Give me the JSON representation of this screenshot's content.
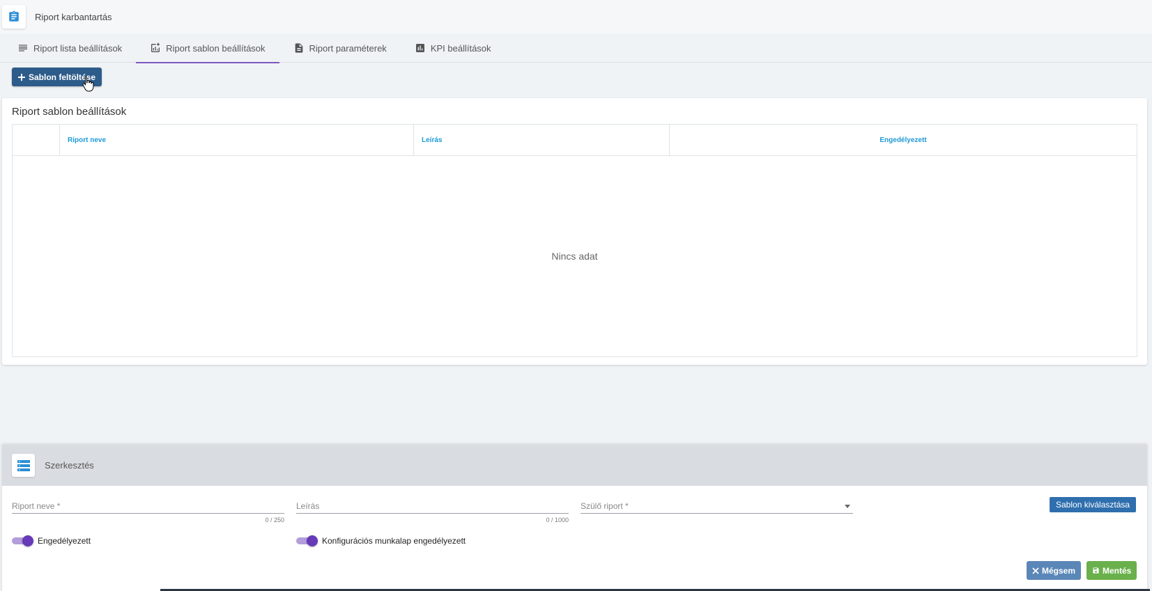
{
  "header": {
    "title": "Riport karbantartás"
  },
  "tabs": [
    {
      "label": "Riport lista beállítások",
      "icon": "list-icon"
    },
    {
      "label": "Riport sablon beállítások",
      "icon": "chart-add-icon",
      "active": true
    },
    {
      "label": "Riport paraméterek",
      "icon": "document-icon"
    },
    {
      "label": "KPI beállítások",
      "icon": "bar-chart-icon"
    }
  ],
  "toolbar": {
    "upload_label": "Sablon feltöltése"
  },
  "card": {
    "title": "Riport sablon beállítások",
    "columns": {
      "name": "Riport neve",
      "description": "Leírás",
      "enabled": "Engedélyezett"
    },
    "empty": "Nincs adat"
  },
  "edit": {
    "title": "Szerkesztés",
    "name_placeholder": "Riport neve *",
    "name_counter": "0 / 250",
    "desc_placeholder": "Leírás",
    "desc_counter": "0 / 1000",
    "parent_placeholder": "Szülő riport *",
    "template_button": "Sablon kiválasztása",
    "toggle_enabled": "Engedélyezett",
    "toggle_config": "Konfigurációs munkalap engedélyezett",
    "cancel_label": "Mégsem",
    "save_label": "Mentés"
  },
  "colors": {
    "accent": "#7e57c2",
    "primary": "#2d5c8a",
    "header_link": "#1e9ad6",
    "save": "#6ab04c",
    "cancel": "#5b87b8"
  }
}
